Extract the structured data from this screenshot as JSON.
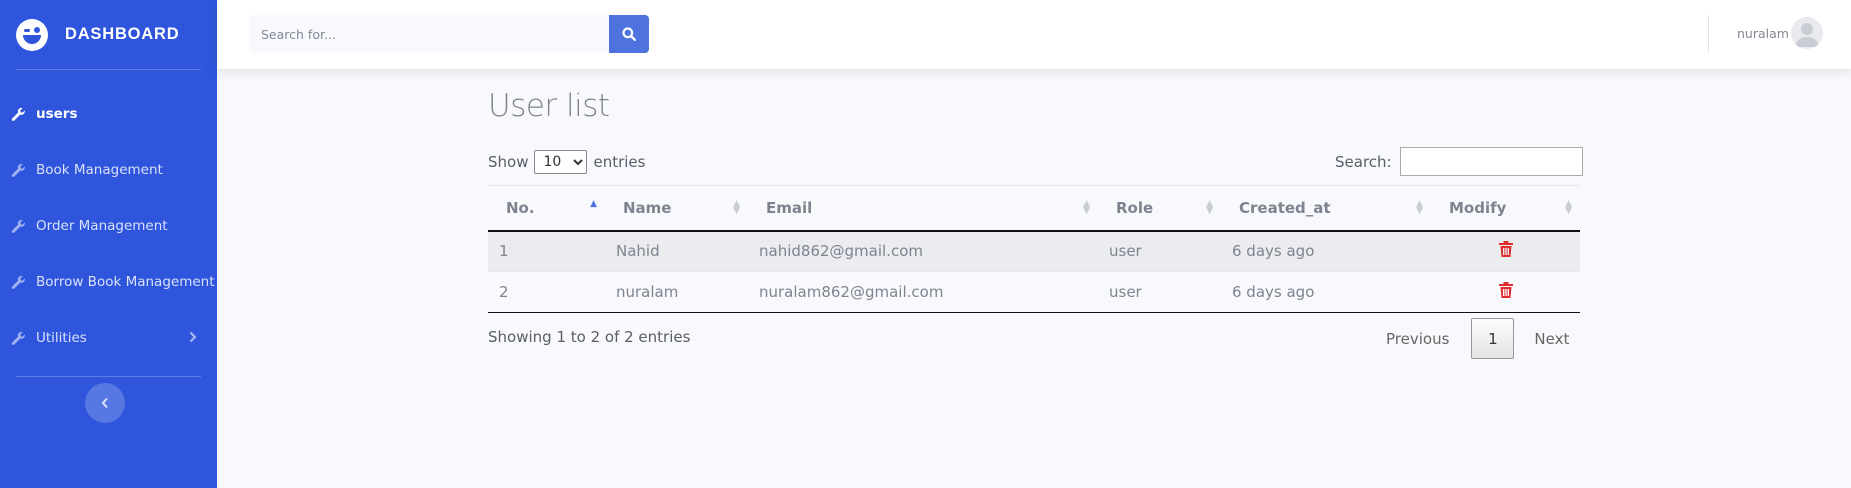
{
  "sidebar": {
    "brand": "DASHBOARD",
    "items": [
      {
        "label": "users",
        "active": true
      },
      {
        "label": "Book Management"
      },
      {
        "label": "Order Management"
      },
      {
        "label": "Borrow Book Management"
      },
      {
        "label": "Utilities"
      }
    ]
  },
  "topbar": {
    "search_placeholder": "Search for...",
    "user_name": "nuralam"
  },
  "main": {
    "title": "User list",
    "length": {
      "prefix": "Show",
      "selected": "10",
      "suffix": "entries"
    },
    "filter_label": "Search:",
    "table": {
      "columns": [
        "No.",
        "Name",
        "Email",
        "Role",
        "Created_at",
        "Modify"
      ],
      "sorted_column": "No.",
      "rows": [
        {
          "no": "1",
          "name": "Nahid",
          "email": "nahid862@gmail.com",
          "role": "user",
          "created_at": "6 days ago"
        },
        {
          "no": "2",
          "name": "nuralam",
          "email": "nuralam862@gmail.com",
          "role": "user",
          "created_at": "6 days ago"
        }
      ]
    },
    "info": "Showing 1 to 2 of 2 entries",
    "pagination": {
      "previous": "Previous",
      "current": "1",
      "next": "Next"
    }
  },
  "colors": {
    "sidebar_bg": "#2e55dc",
    "accent": "#4e73df",
    "delete": "#e02d2d"
  }
}
